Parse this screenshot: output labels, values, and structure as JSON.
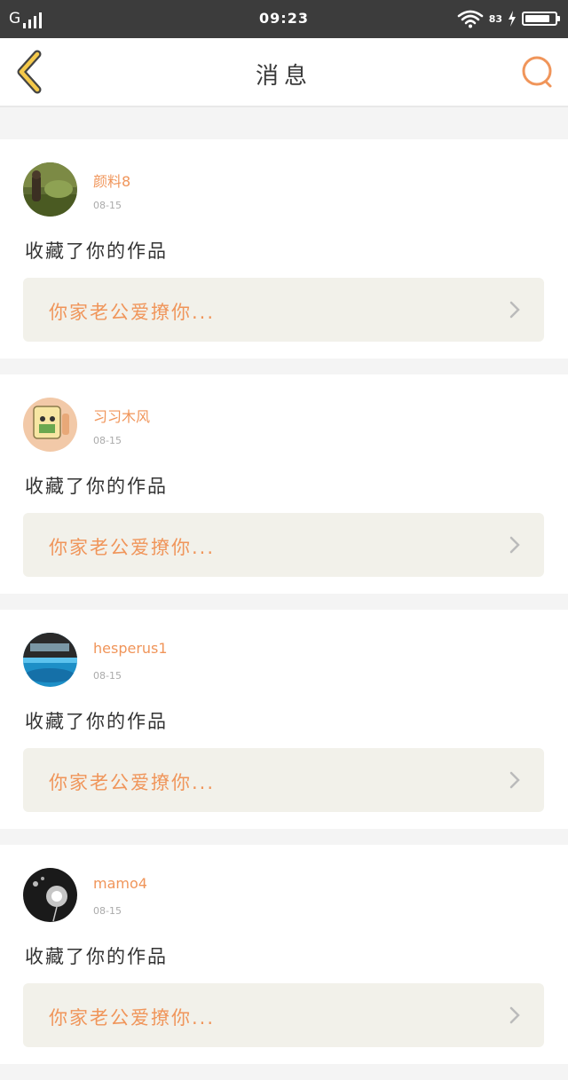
{
  "status_bar": {
    "network": "G",
    "time": "09:23",
    "battery_percent": "83",
    "battery_level": 0.83
  },
  "header": {
    "title": "消息",
    "back_icon": "chevron-left-icon",
    "search_icon": "search-icon"
  },
  "colors": {
    "accent": "#f0955a",
    "back_icon": "#f5c94a",
    "card_link_bg": "#f2f1ea",
    "page_bg": "#f4f4f4"
  },
  "notifications": [
    {
      "username": "颜料8",
      "date": "08-15",
      "message": "收藏了你的作品",
      "work_title": "你家老公爱撩你..."
    },
    {
      "username": "习习木风",
      "date": "08-15",
      "message": "收藏了你的作品",
      "work_title": "你家老公爱撩你..."
    },
    {
      "username": "hesperus1",
      "date": "08-15",
      "message": "收藏了你的作品",
      "work_title": "你家老公爱撩你..."
    },
    {
      "username": "mamo4",
      "date": "08-15",
      "message": "收藏了你的作品",
      "work_title": "你家老公爱撩你..."
    }
  ]
}
